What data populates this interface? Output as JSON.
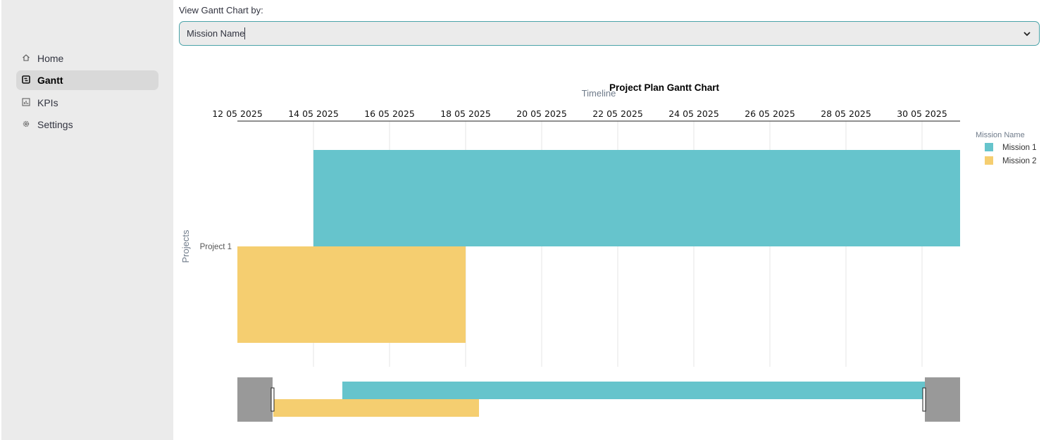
{
  "sidebar": {
    "items": [
      {
        "label": "Home",
        "icon": "home-icon"
      },
      {
        "label": "Gantt",
        "icon": "gantt-icon",
        "active": true
      },
      {
        "label": "KPIs",
        "icon": "kpi-chart-icon"
      },
      {
        "label": "Settings",
        "icon": "gear-icon"
      }
    ]
  },
  "selector": {
    "label": "View Gantt Chart by:",
    "value": "Mission Name"
  },
  "chart_data": {
    "type": "gantt",
    "title": "Project Plan Gantt Chart",
    "xlabel": "Timeline",
    "ylabel": "Projects",
    "x_ticks": [
      "12 05 2025",
      "14 05 2025",
      "16 05 2025",
      "18 05 2025",
      "20 05 2025",
      "22 05 2025",
      "24 05 2025",
      "26 05 2025",
      "28 05 2025",
      "30 05 2025"
    ],
    "categories": [
      "Project 1"
    ],
    "legend_title": "Mission Name",
    "legend_position": "right",
    "grid": true,
    "rangeslider": true,
    "series": [
      {
        "name": "Mission 1",
        "color": "#66c4cc",
        "category": "Project 1",
        "start": "2025-05-14",
        "end": "2025-05-31"
      },
      {
        "name": "Mission 2",
        "color": "#f5ce70",
        "category": "Project 1",
        "start": "2025-05-12",
        "end": "2025-05-18"
      }
    ]
  }
}
